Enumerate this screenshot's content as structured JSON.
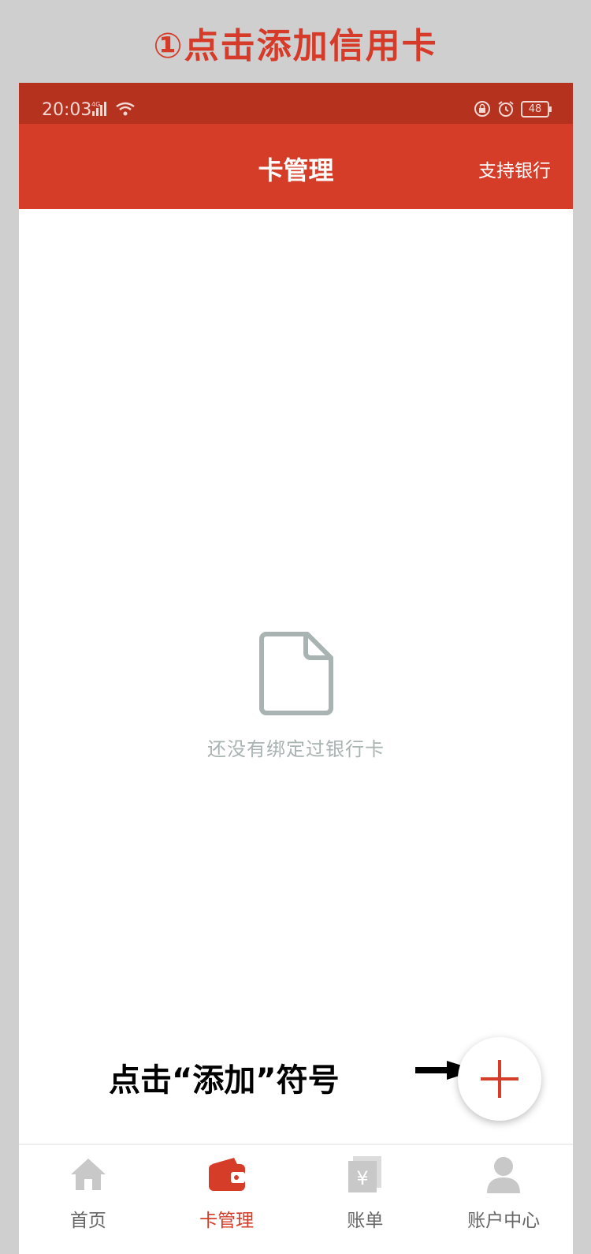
{
  "instruction": {
    "title": "①点击添加信用卡"
  },
  "status_bar": {
    "time": "20:03",
    "network": "4G",
    "battery": "48"
  },
  "header": {
    "title": "卡管理",
    "right_action": "支持银行"
  },
  "empty_state": {
    "icon": "document-icon",
    "message": "还没有绑定过银行卡"
  },
  "hint": {
    "text": "点击“添加”符号"
  },
  "fab": {
    "icon": "plus-icon",
    "accent": "#d53d29"
  },
  "tabs": [
    {
      "label": "首页",
      "icon": "home-icon",
      "active": false
    },
    {
      "label": "卡管理",
      "icon": "wallet-icon",
      "active": true
    },
    {
      "label": "账单",
      "icon": "bill-icon",
      "active": false
    },
    {
      "label": "账户中心",
      "icon": "user-icon",
      "active": false
    }
  ],
  "colors": {
    "brand": "#d53d29",
    "status_bar": "#b5321f",
    "inactive_icon": "#c8c8c8",
    "empty_gray": "#a9b3b2"
  }
}
